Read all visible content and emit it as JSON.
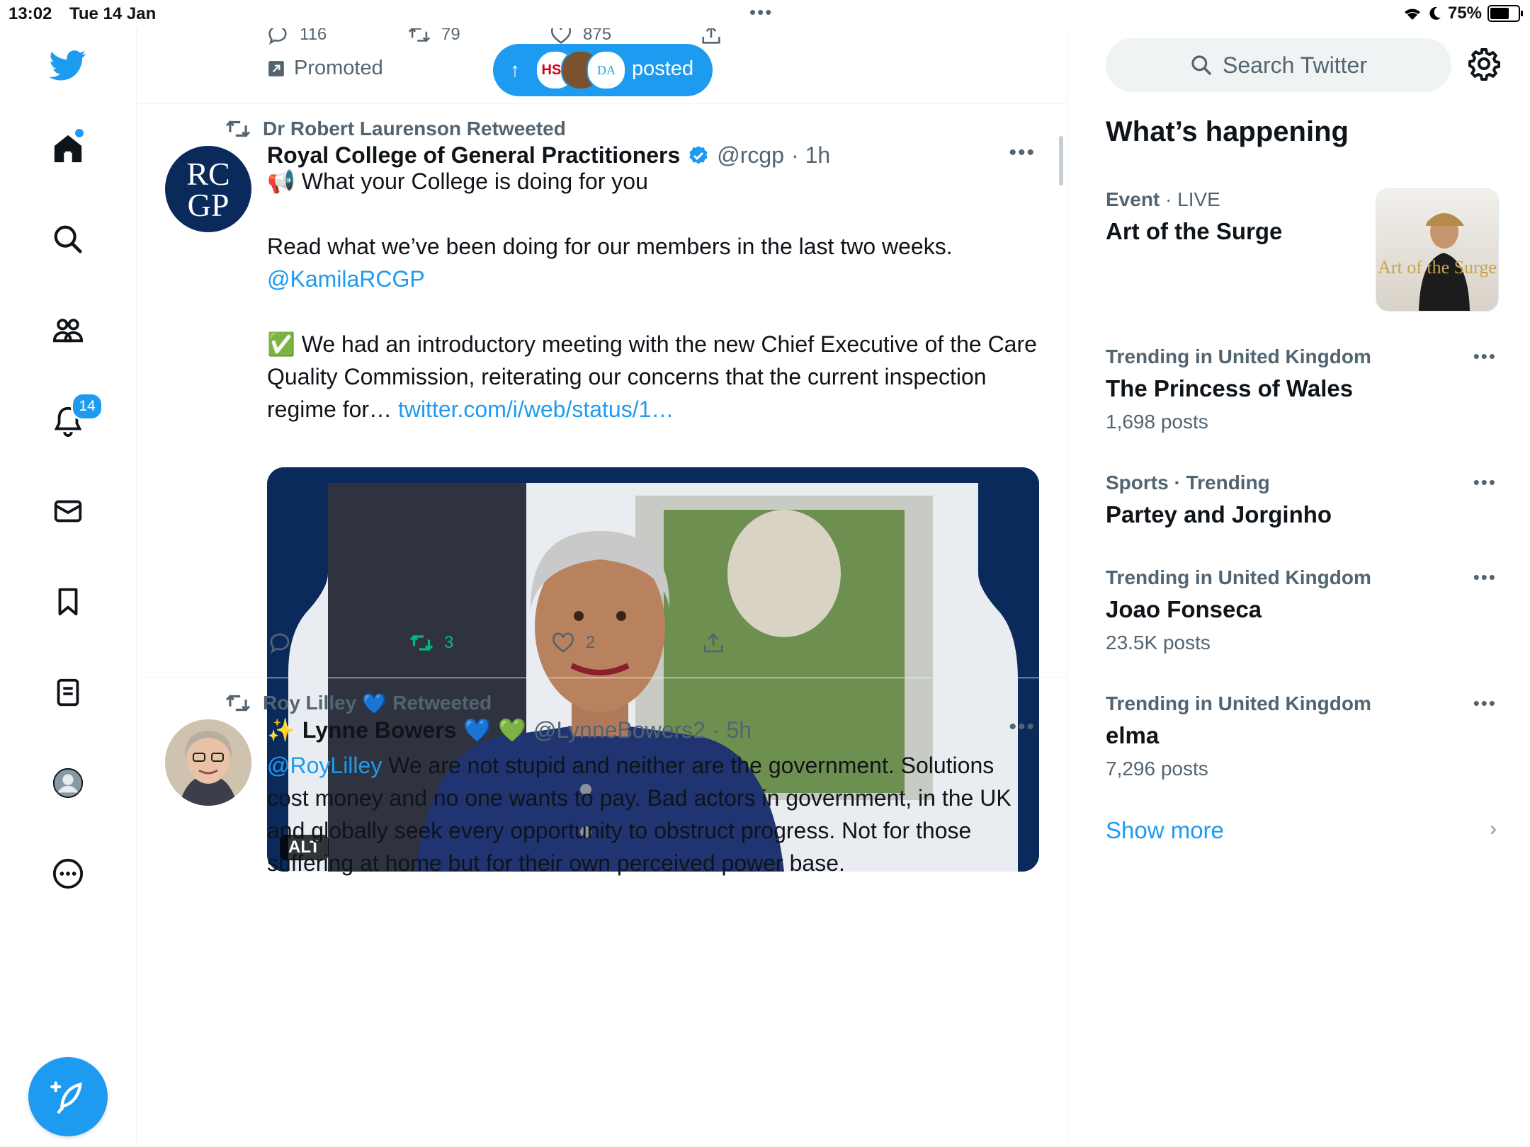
{
  "status_bar": {
    "time": "13:02",
    "date": "Tue 14 Jan",
    "battery": "75%",
    "battery_level": 0.75
  },
  "sidebar": {
    "notifications_badge": "14"
  },
  "prev_tweet": {
    "replies": "116",
    "retweets": "79",
    "likes": "875",
    "promoted_label": "Promoted"
  },
  "new_posts_pill": {
    "label": "posted",
    "avatar1": "HSJ",
    "avatar3": "DA"
  },
  "tweet1": {
    "retweeted_by": "Dr Robert Laurenson Retweeted",
    "avatar_text_top": "RC",
    "avatar_text_bottom": "GP",
    "name": "Royal College of General Practitioners",
    "handle": "@rcgp",
    "time": "· 1h",
    "line1": "📢 What your College is doing for you",
    "line2": "Read what we’ve been doing for our members in the last two weeks.",
    "mention": "@KamilaRCGP",
    "line3": "✅ We had an introductory meeting with the new Chief Executive of the Care Quality Commission, reiterating our concerns that the current inspection regime for…",
    "link": "twitter.com/i/web/status/1…",
    "alt_label": "ALT",
    "retweets": "3",
    "likes": "2"
  },
  "tweet2": {
    "retweeted_by_name": "Roy Lilley",
    "retweeted_suffix": "Retweeted",
    "sparkle": "✨",
    "name": "Lynne Bowers",
    "hearts": "💙 💚",
    "blue_heart": "💙",
    "handle": "@LynneBowers2",
    "time": "· 5h",
    "mention": "@RoyLilley",
    "text": "We are not stupid and neither are the government. Solutions cost money and no one wants to pay. Bad actors in government, in the UK and globally seek every opportunity to obstruct progress. Not for those suffering at home but for their own perceived power base."
  },
  "right_panel": {
    "search_placeholder": "Search Twitter",
    "whats_happening": "What’s happening",
    "event": {
      "category": "Event",
      "status": "· LIVE",
      "title": "Art of the Surge",
      "image_text": "Art of the Surge"
    },
    "trends": [
      {
        "meta": "Trending in United Kingdom",
        "topic": "The Princess of Wales",
        "count": "1,698 posts"
      },
      {
        "meta": "Sports · Trending",
        "topic": "Partey and Jorginho",
        "count": ""
      },
      {
        "meta": "Trending in United Kingdom",
        "topic": "Joao Fonseca",
        "count": "23.5K posts"
      },
      {
        "meta": "Trending in United Kingdom",
        "topic": "elma",
        "count": "7,296 posts"
      }
    ],
    "show_more": "Show more"
  },
  "colors": {
    "accent": "#1d9bf0",
    "retweet_green": "#00ba7c",
    "muted": "#536471",
    "rcgp_navy": "#0b2a5c"
  }
}
